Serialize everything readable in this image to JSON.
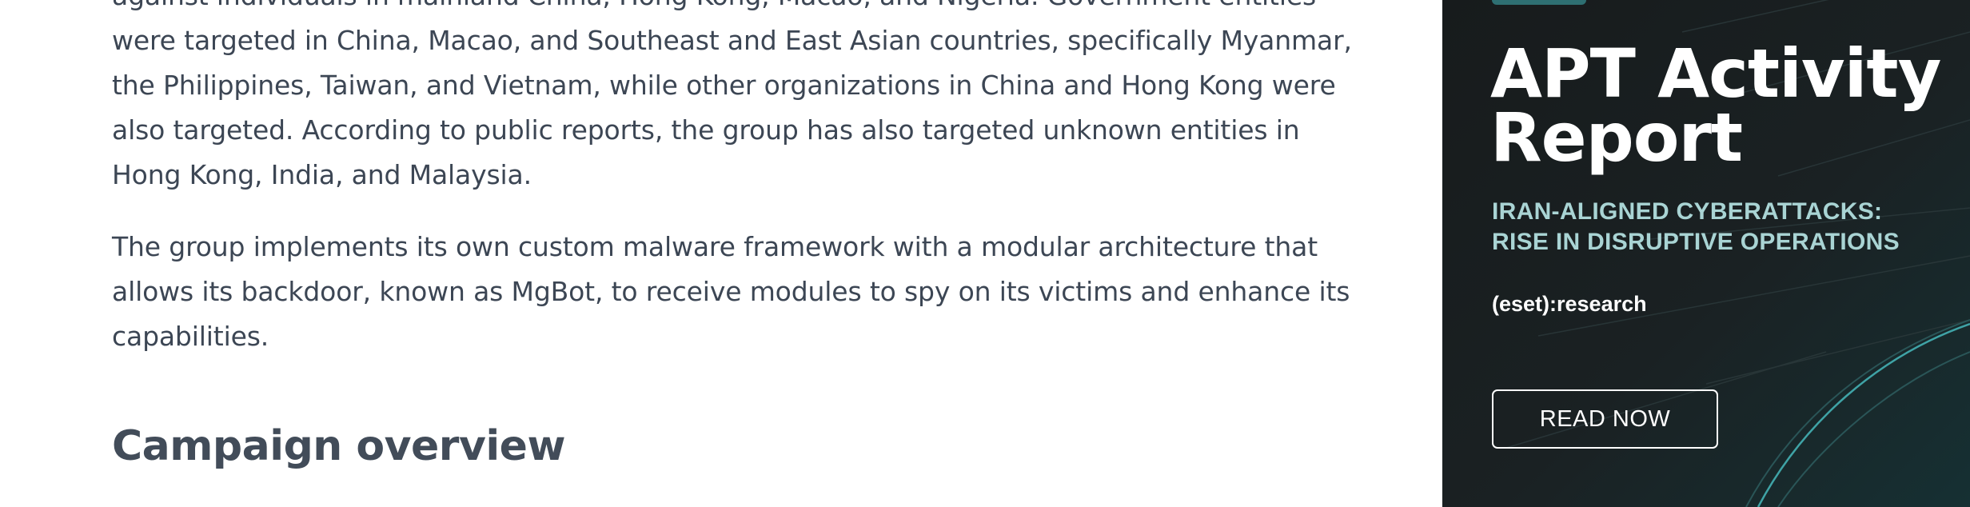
{
  "article": {
    "paragraphs": [
      "against individuals in mainland China, Hong Kong, Macao, and Nigeria. Government entities were targeted in China, Macao, and Southeast and East Asian countries, specifically Myanmar, the Philippines, Taiwan, and Vietnam, while other organizations in China and Hong Kong were also targeted. According to public reports, the group has also targeted unknown entities in Hong Kong, India, and Malaysia.",
      "The group implements its own custom malware framework with a modular architecture that allows its backdoor, known as MgBot, to receive modules to spy on its victims and enhance its capabilities."
    ],
    "heading": "Campaign overview"
  },
  "ad": {
    "title": "APT Activity Report",
    "subtitle": "IRAN-ALIGNED CYBERATTACKS: RISE IN DISRUPTIVE OPERATIONS",
    "brand": "(eset):research",
    "cta_label": "READ NOW"
  },
  "colors": {
    "body_text": "#3c4654",
    "heading_text": "#424c59",
    "ad_background": "#181d1e",
    "ad_accent": "#a9d4d4",
    "ad_line": "#3fa3a6"
  }
}
